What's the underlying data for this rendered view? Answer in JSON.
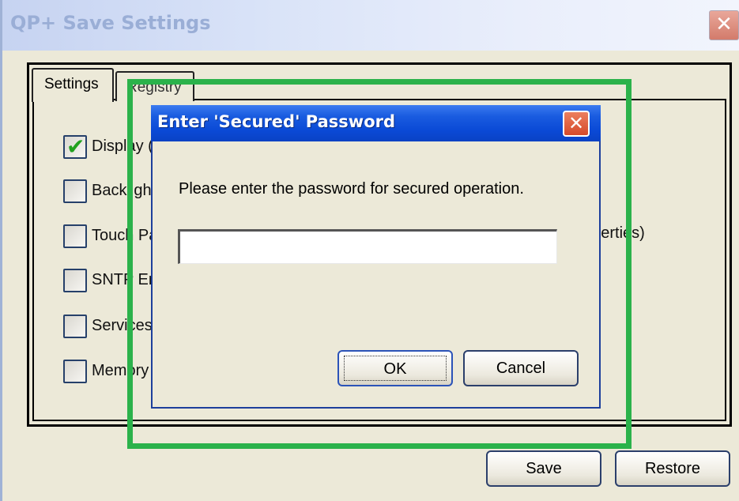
{
  "window": {
    "title": "QP+ Save Settings",
    "close_glyph": "✕",
    "tabs": [
      {
        "label": "Settings",
        "active": true
      },
      {
        "label": "Registry",
        "active": false
      }
    ],
    "options": [
      {
        "label": "Display (",
        "checked": true
      },
      {
        "label": "Backlight",
        "checked": false
      },
      {
        "label": "Touch Pa",
        "checked": false
      },
      {
        "label": "SNTP En",
        "checked": false
      },
      {
        "label": "Services",
        "checked": false
      },
      {
        "label": "Memory",
        "checked": false
      }
    ],
    "partial_text": "operties)",
    "buttons": {
      "save": "Save",
      "restore": "Restore"
    }
  },
  "dialog": {
    "title": "Enter 'Secured'  Password",
    "close_glyph": "✕",
    "message": "Please enter the password for secured operation.",
    "password_value": "",
    "buttons": {
      "ok": "OK",
      "cancel": "Cancel"
    }
  },
  "colors": {
    "highlight": "#2bb24b",
    "dialog_titlebar": "#0a49d6",
    "checkmark": "#22a11f"
  },
  "icons": {
    "window_close": "close-icon",
    "dialog_close": "close-icon",
    "checkbox_check": "checkmark-icon"
  }
}
